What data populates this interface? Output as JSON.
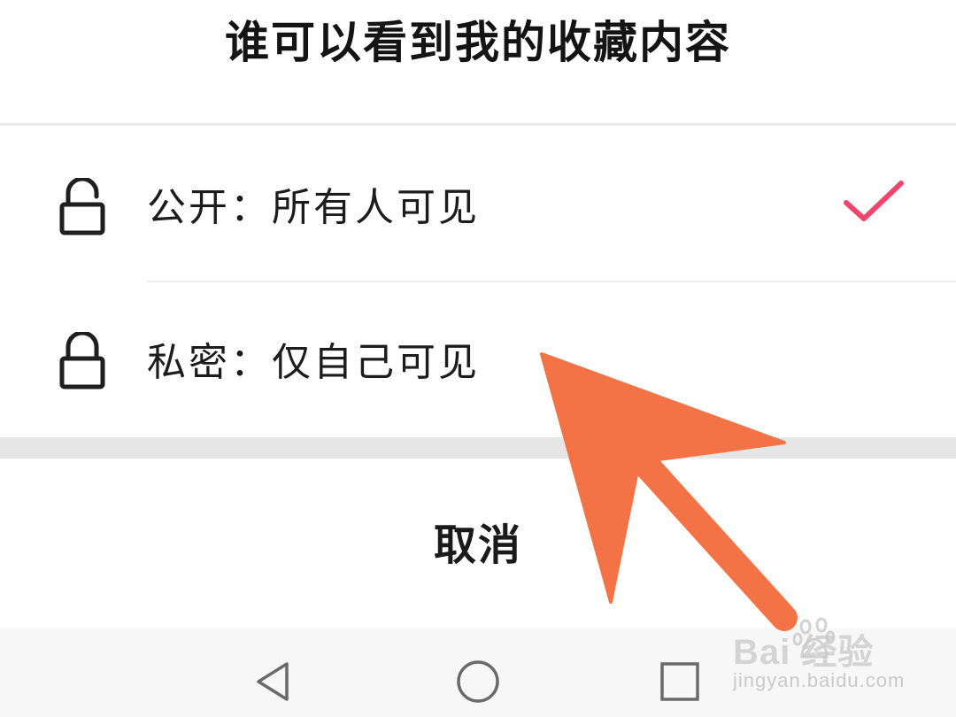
{
  "dialog": {
    "title": "谁可以看到我的收藏内容",
    "options": [
      {
        "label": "公开：所有人可见",
        "icon": "unlocked-padlock-icon",
        "selected": true
      },
      {
        "label": "私密：仅自己可见",
        "icon": "locked-padlock-icon",
        "selected": false
      }
    ],
    "cancel_label": "取消"
  },
  "navbar": {
    "back_icon": "triangle-back-icon",
    "home_icon": "circle-home-icon",
    "recent_icon": "square-recents-icon"
  },
  "watermark": {
    "brand": "Bai  经验",
    "sub": "jingyan.baidu.com"
  },
  "colors": {
    "accent_check": "#f0466e",
    "annotation_arrow": "#f37346",
    "text": "#1a1a1a",
    "divider": "#ebebeb",
    "section_gap": "#e6e6e6",
    "navbar_bg": "#f7f7f7"
  }
}
